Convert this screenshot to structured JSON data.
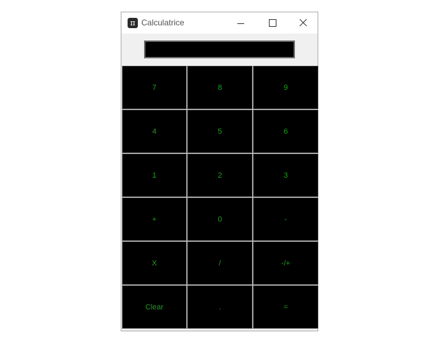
{
  "window": {
    "title": "Calculatrice",
    "icon": "pi-icon",
    "icon_glyph": "π",
    "controls": [
      "minimize",
      "maximize",
      "close"
    ]
  },
  "display": {
    "value": ""
  },
  "keys": [
    {
      "label": "7",
      "name": "key-7"
    },
    {
      "label": "8",
      "name": "key-8"
    },
    {
      "label": "9",
      "name": "key-9"
    },
    {
      "label": "4",
      "name": "key-4"
    },
    {
      "label": "5",
      "name": "key-5"
    },
    {
      "label": "6",
      "name": "key-6"
    },
    {
      "label": "1",
      "name": "key-1"
    },
    {
      "label": "2",
      "name": "key-2"
    },
    {
      "label": "3",
      "name": "key-3"
    },
    {
      "label": "+",
      "name": "key-plus"
    },
    {
      "label": "0",
      "name": "key-0"
    },
    {
      "label": "-",
      "name": "key-minus"
    },
    {
      "label": "X",
      "name": "key-multiply"
    },
    {
      "label": "/",
      "name": "key-divide"
    },
    {
      "label": "-/+",
      "name": "key-negate"
    },
    {
      "label": "Clear",
      "name": "key-clear"
    },
    {
      "label": ".",
      "name": "key-decimal"
    },
    {
      "label": "=",
      "name": "key-equals"
    }
  ],
  "colors": {
    "key_background": "#000000",
    "key_text": "#1f9f1f",
    "display_background": "#000000",
    "window_background": "#f0f0f0"
  }
}
